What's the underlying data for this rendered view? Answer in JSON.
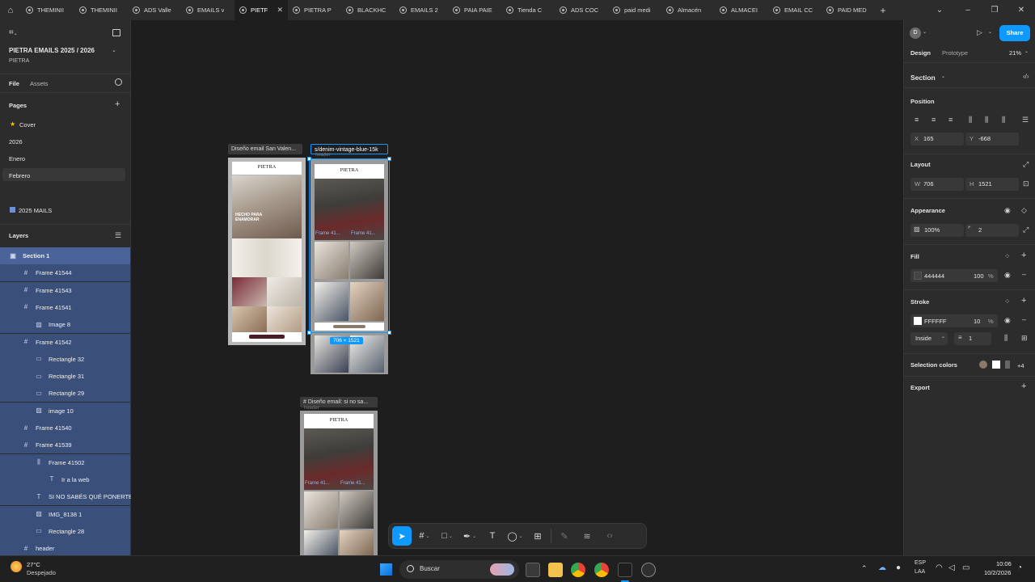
{
  "tabs": [
    {
      "label": "THEMINII"
    },
    {
      "label": "THEMINII"
    },
    {
      "label": "ADS Valle"
    },
    {
      "label": "EMAILS v"
    },
    {
      "label": "PIETF",
      "active": true
    },
    {
      "label": "PIETRA P"
    },
    {
      "label": "BLACKHC"
    },
    {
      "label": "EMAILS 2"
    },
    {
      "label": "PAIA PAIE"
    },
    {
      "label": "Tienda C"
    },
    {
      "label": "ADS COC"
    },
    {
      "label": "paid medi"
    },
    {
      "label": "Almacén"
    },
    {
      "label": "ALMACEI"
    },
    {
      "label": "EMAIL CC"
    },
    {
      "label": "PAID MED"
    }
  ],
  "file": {
    "title": "PIETRA EMAILS 2025 / 2026",
    "project": "PIETRA"
  },
  "left_tabs": {
    "file": "File",
    "assets": "Assets"
  },
  "pages": {
    "title": "Pages",
    "items": [
      {
        "label": "Cover",
        "icon": "star-icon"
      },
      {
        "label": "2026"
      },
      {
        "label": "Enero"
      },
      {
        "label": "Febrero",
        "selected": true
      },
      {
        "label": "2025 MAILS"
      }
    ]
  },
  "layers": {
    "title": "Layers",
    "items": [
      {
        "label": "Section 1",
        "level": 0,
        "icon": "section"
      },
      {
        "label": "Frame 41544",
        "level": 1,
        "icon": "frame"
      },
      {
        "label": "Frame 41543",
        "level": 1,
        "icon": "frame"
      },
      {
        "label": "Frame 41541",
        "level": 1,
        "icon": "frame"
      },
      {
        "label": "Image 8",
        "level": 2,
        "icon": "image"
      },
      {
        "label": "Frame 41542",
        "level": 1,
        "icon": "frame"
      },
      {
        "label": "Rectangle 32",
        "level": 2,
        "icon": "rect"
      },
      {
        "label": "Rectangle 31",
        "level": 2,
        "icon": "rect"
      },
      {
        "label": "Rectangle 29",
        "level": 2,
        "icon": "rect"
      },
      {
        "label": "image 10",
        "level": 2,
        "icon": "image"
      },
      {
        "label": "Frame 41540",
        "level": 1,
        "icon": "frame"
      },
      {
        "label": "Frame 41539",
        "level": 1,
        "icon": "frame"
      },
      {
        "label": "Frame 41502",
        "level": 2,
        "icon": "autolayout"
      },
      {
        "label": "Ir a la web",
        "level": 3,
        "icon": "text"
      },
      {
        "label": "SI NO SABÉS QUÉ PONERTE",
        "level": 2,
        "icon": "text"
      },
      {
        "label": "IMG_8138 1",
        "level": 2,
        "icon": "image"
      },
      {
        "label": "Rectangle 28",
        "level": 2,
        "icon": "rect"
      },
      {
        "label": "header",
        "level": 1,
        "icon": "frame"
      }
    ]
  },
  "canvas": {
    "frame1_label": "Diseño email San Valen...",
    "frame2_input": "s/denim-vintage-blue-15k",
    "frame3_label": "# Diseño email: si no sa...",
    "header_text": "header",
    "logo": "PIETRA",
    "hero1_text": "HECHO PARA ENAMORAR",
    "frame_tag1": "Frame 41...",
    "frame_tag2": "Frame 41...",
    "size_badge": "706 × 1521"
  },
  "right": {
    "avatar": "D",
    "share": "Share",
    "tab_design": "Design",
    "tab_prototype": "Prototype",
    "zoom": "21%",
    "section": "Section",
    "position": "Position",
    "x_label": "X",
    "x_value": "165",
    "y_label": "Y",
    "y_value": "-668",
    "layout": "Layout",
    "w_label": "W",
    "w_value": "706",
    "h_label": "H",
    "h_value": "1521",
    "appearance": "Appearance",
    "opacity": "100%",
    "radius": "2",
    "fill": "Fill",
    "fill_hex": "444444",
    "fill_opacity": "100",
    "fill_pct": "%",
    "stroke": "Stroke",
    "stroke_hex": "FFFFFF",
    "stroke_opacity": "10",
    "stroke_pct": "%",
    "stroke_align": "Inside",
    "stroke_weight": "1",
    "selection_colors": "Selection colors",
    "selection_more": "+4",
    "export": "Export"
  },
  "taskbar": {
    "temp": "27°C",
    "weather": "Despejado",
    "search": "Buscar",
    "lang1": "ESP",
    "lang2": "LAA",
    "time": "10:06",
    "date": "10/2/2026"
  },
  "colors": {
    "accent": "#0d99ff",
    "panel": "#2c2c2c",
    "canvas": "#1e1e1e",
    "layer_sel": "#3a4f7a"
  }
}
